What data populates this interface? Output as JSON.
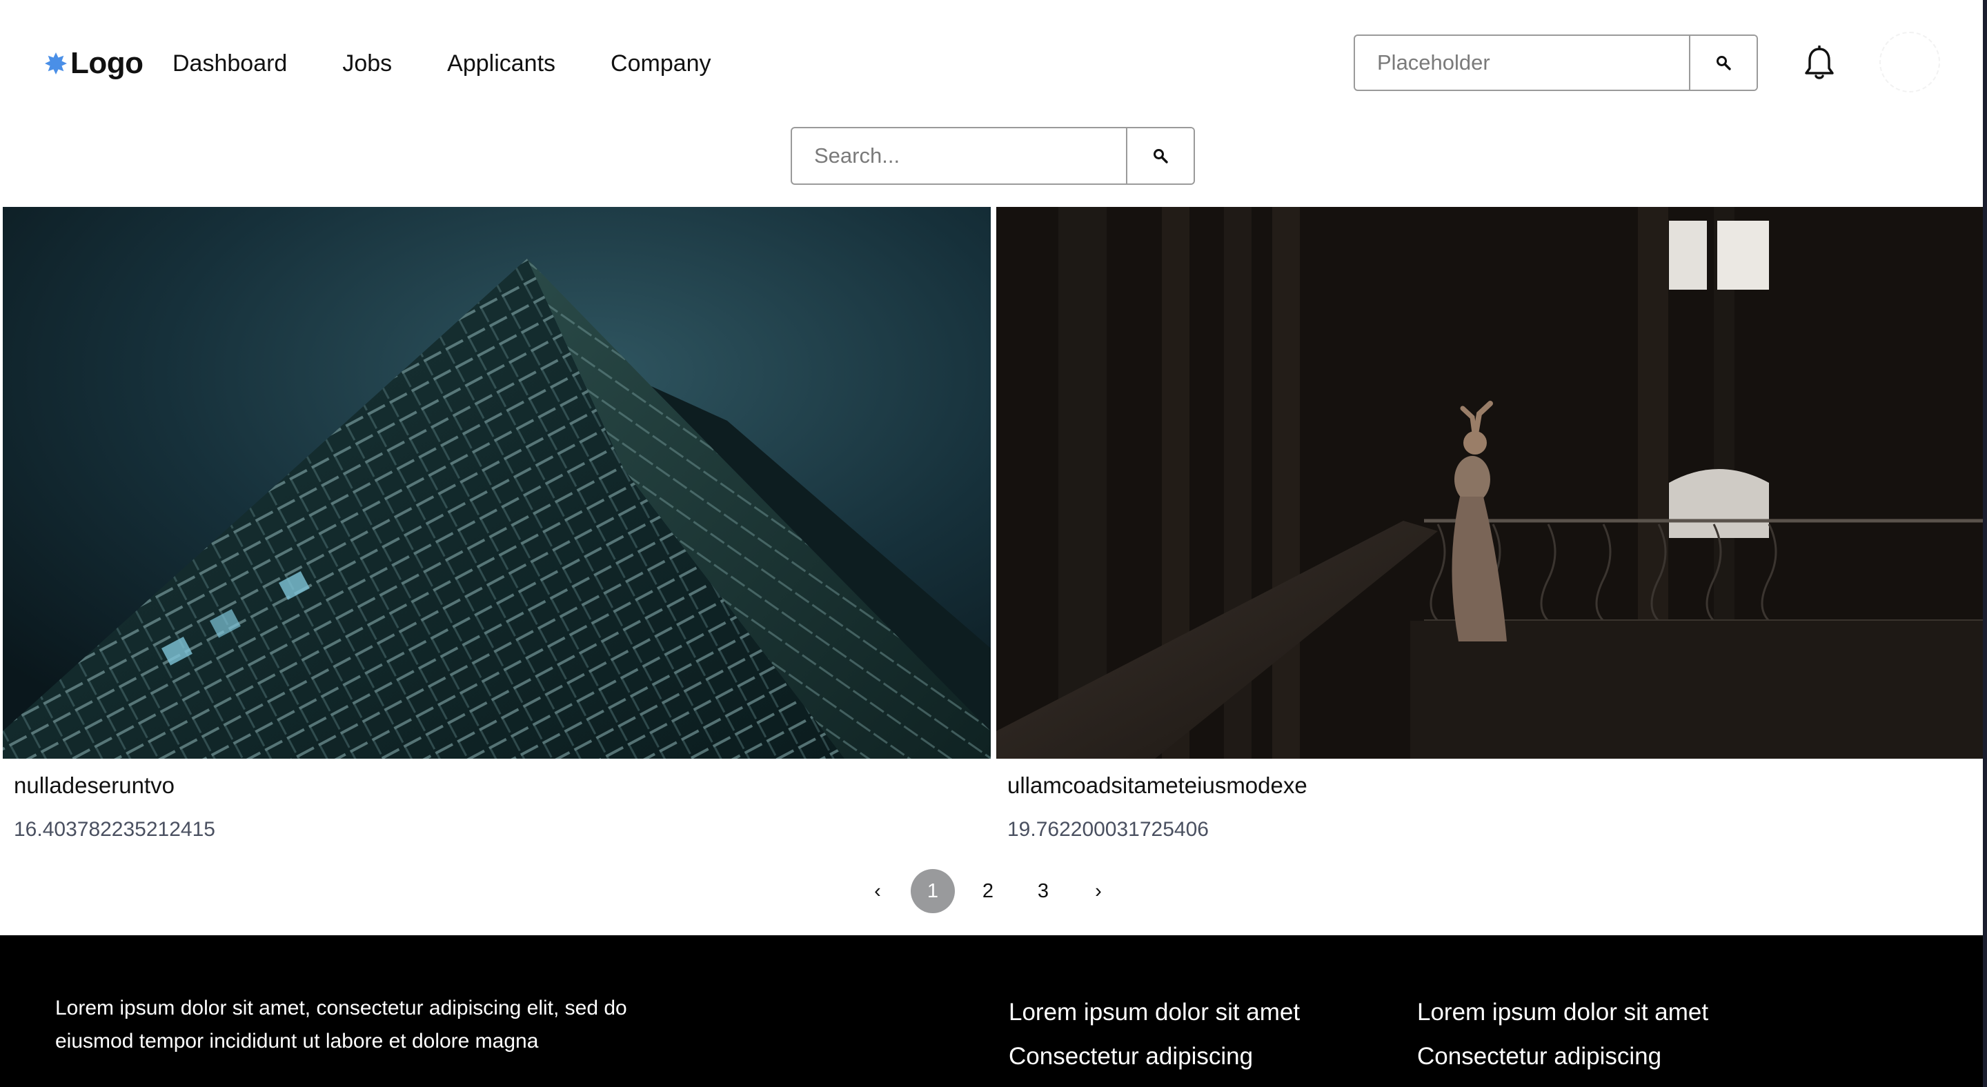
{
  "header": {
    "logo_text": "Logo",
    "nav": [
      "Dashboard",
      "Jobs",
      "Applicants",
      "Company"
    ],
    "search": {
      "placeholder": "Placeholder"
    }
  },
  "main_search": {
    "placeholder": "Search..."
  },
  "cards": [
    {
      "title": "nulladeseruntvo",
      "value": "16.403782235212415",
      "image": "night-skyscraper-photo"
    },
    {
      "title": "ullamcoadsitameteiusmodexe",
      "value": "19.762200031725406",
      "image": "dancer-on-balcony-photo"
    }
  ],
  "pagination": {
    "prev": "‹",
    "pages": [
      "1",
      "2",
      "3"
    ],
    "current": "1",
    "next": "›"
  },
  "footer": {
    "about": "Lorem ipsum dolor sit amet, consectetur adipiscing elit, sed do eiusmod tempor incididunt ut labore et dolore magna",
    "columns": [
      {
        "links": [
          "Lorem ipsum dolor sit amet",
          "Consectetur adipiscing"
        ]
      },
      {
        "links": [
          "Lorem ipsum dolor sit amet",
          "Consectetur adipiscing"
        ]
      }
    ]
  },
  "colors": {
    "logo_accent": "#4a8fe7",
    "footer_bg": "#000000",
    "active_page_bg": "#999a9c",
    "secondary_text": "#4a5060"
  }
}
